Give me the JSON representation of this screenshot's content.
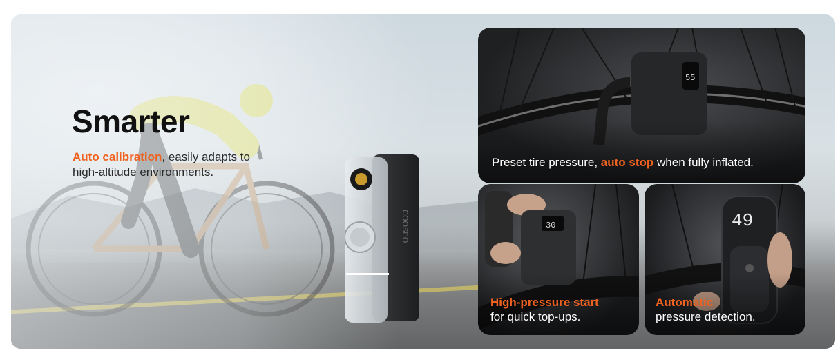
{
  "hero": {
    "title": "Smarter",
    "description_highlight": "Auto calibration",
    "description_rest_line1": ", easily adapts to",
    "description_line2": "high-altitude environments."
  },
  "cards": {
    "top": {
      "prefix": "Preset tire pressure, ",
      "highlight": "auto stop",
      "suffix": " when fully inflated."
    },
    "bottom_left": {
      "highlight": "High-pressure start",
      "line2": "for quick top-ups."
    },
    "bottom_right": {
      "highlight": "Automatic",
      "line2": "pressure detection."
    }
  },
  "device": {
    "brand_mark": "COOSPO",
    "display_top": "55",
    "display_left": "30",
    "display_right": "49"
  },
  "colors": {
    "accent": "#f0621f",
    "headline": "#111111",
    "card_text": "#ffffff"
  }
}
